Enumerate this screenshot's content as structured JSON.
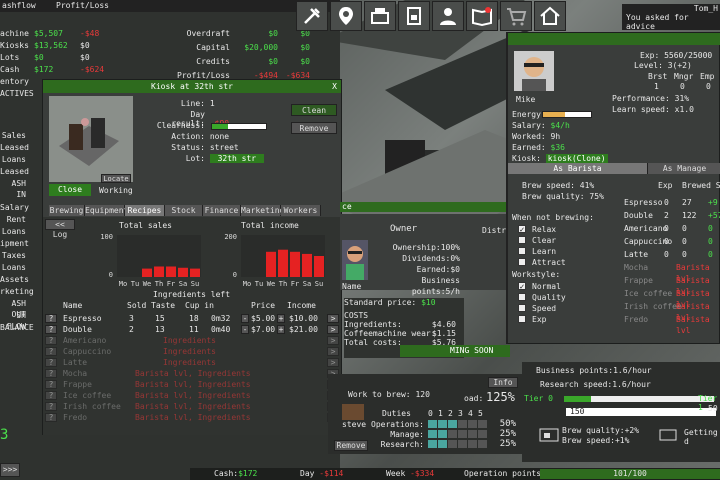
{
  "top_bar": {
    "cashflow": "ashflow",
    "profit_loss": "Profit/Loss",
    "user": "Tom_H"
  },
  "left_list": [
    {
      "label": "achine",
      "a": "$5,507",
      "b": "-$48"
    },
    {
      "label": "Kiosks",
      "a": "$13,562",
      "b": "$0"
    },
    {
      "label": "Lots",
      "a": "$0",
      "b": "$0"
    },
    {
      "label": "Cash",
      "a": "$172",
      "b": "-$624"
    },
    {
      "label": "entory",
      "a": "",
      "b": ""
    },
    {
      "label": "ACTIVES",
      "a": "",
      "b": "1"
    }
  ],
  "left_labels": [
    "Sales",
    "Leased",
    "Loans",
    "Leased",
    "ASH IN",
    "Salary",
    "Rent",
    "Loans",
    "ipment",
    "Taxes",
    "Loans",
    "Assets",
    "rketing",
    "ASH OUT",
    "SH FLOW",
    "BALANCE"
  ],
  "left_big": "3",
  "chat_btn": ">>>",
  "right_ledger": [
    {
      "label": "Overdraft",
      "a": "$0",
      "b": "$0"
    },
    {
      "label": "Capital",
      "a": "$20,000",
      "b": "$0"
    },
    {
      "label": "Credits",
      "a": "$0",
      "b": "$0"
    },
    {
      "label": "Profit/Loss",
      "a": "-$494",
      "b": "-$634"
    }
  ],
  "icons": [
    "tools-icon",
    "map-pin-icon",
    "register-icon",
    "coffee-machine-icon",
    "person-icon",
    "book-icon",
    "cart-icon",
    "home-icon"
  ],
  "notice": {
    "title": "Tom_H",
    "text": "You asked for advice"
  },
  "kiosk": {
    "title": "Kiosk at 32th str",
    "close_x": "X",
    "line_label": "Line:",
    "line": "1",
    "day_result_label": "Day result:",
    "day_result": "-$90",
    "clearness_label": "Clearness:",
    "clearness": 0.3,
    "action_label": "Action:",
    "action": "none",
    "status_label": "Status:",
    "status": "street",
    "lot_label": "Lot:",
    "lot": "32th str",
    "clean_btn": "Clean",
    "remove_btn": "Remove",
    "locate_btn": "Locate",
    "close_btn": "Close",
    "working": "Working",
    "tabs": [
      "Brewing",
      "Equipment",
      "Recipes",
      "Stock",
      "Finance",
      "Marketing",
      "Workers"
    ],
    "log_btn": "<< Log",
    "sales_title": "Total sales",
    "sales_max": "100",
    "sales_min": "0",
    "income_title": "Total income",
    "income_max": "200",
    "income_min": "0",
    "days": [
      "Mo",
      "Tu",
      "We",
      "Th",
      "Fr",
      "Sa",
      "Su"
    ],
    "sales_vals": [
      0,
      0,
      20,
      25,
      25,
      22,
      20
    ],
    "income_vals": [
      0,
      0,
      120,
      130,
      120,
      110,
      100
    ],
    "ingredients_left": "Ingredients left",
    "headers": [
      "Name",
      "Sold",
      "Taste",
      "Cup in",
      "Price",
      "Income"
    ],
    "recipes": [
      {
        "name": "Espresso",
        "sold": "3",
        "taste": "15",
        "qty": "18",
        "cup": "0m32",
        "price": "$5.00",
        "income": "$10.00",
        "active": true
      },
      {
        "name": "Double",
        "sold": "2",
        "taste": "13",
        "qty": "11",
        "cup": "0m40",
        "price": "$7.00",
        "income": "$21.00",
        "active": true
      },
      {
        "name": "Americano",
        "sold": "",
        "taste": "",
        "qty": "",
        "cup": "Ingredients",
        "price": "",
        "income": "",
        "active": false
      },
      {
        "name": "Cappuccino",
        "sold": "",
        "taste": "",
        "qty": "",
        "cup": "Ingredients",
        "price": "",
        "income": "",
        "active": false
      },
      {
        "name": "Latte",
        "sold": "",
        "taste": "",
        "qty": "",
        "cup": "Ingredients",
        "price": "",
        "income": "",
        "active": false
      },
      {
        "name": "Mocha",
        "sold": "",
        "taste": "",
        "qty": "",
        "cup": "Barista lvl, Ingredients",
        "price": "",
        "income": "",
        "active": false
      },
      {
        "name": "Frappe",
        "sold": "",
        "taste": "",
        "qty": "",
        "cup": "Barista lvl, Ingredients",
        "price": "",
        "income": "",
        "active": false
      },
      {
        "name": "Ice coffee",
        "sold": "",
        "taste": "",
        "qty": "",
        "cup": "Barista lvl, Ingredients",
        "price": "",
        "income": "",
        "active": false
      },
      {
        "name": "Irish coffee",
        "sold": "",
        "taste": "",
        "qty": "",
        "cup": "Barista lvl, Ingredients",
        "price": "",
        "income": "",
        "active": false
      },
      {
        "name": "Fredo",
        "sold": "",
        "taste": "",
        "qty": "",
        "cup": "Barista lvl, Ingredients",
        "price": "",
        "income": "",
        "active": false
      }
    ]
  },
  "owner": {
    "title": "Owner",
    "name": "Name",
    "ownership_label": "Ownership:",
    "ownership": "100%",
    "dividends_label": "Dividends:",
    "dividends": "0%",
    "earned_label": "Earned:",
    "earned": "$0",
    "bp_label": "Business points:",
    "bp": "5/h",
    "distr": "Distri",
    "standard_price_label": "Standard price:",
    "standard_price": "$10",
    "costs": "COSTS",
    "ingredients_label": "Ingredients:",
    "ingredients": "$4.60",
    "wear_label": "Coffeemachine wear:",
    "wear": "$1.15",
    "total_label": "Total costs:",
    "total": "$5.76",
    "ce": "ce"
  },
  "work": {
    "label": "Work to brew:",
    "value": "120",
    "load": "oad:",
    "load_pct": "125%",
    "worker": "steve",
    "remove": "Remove",
    "info": "Info",
    "duties_label": "Duties",
    "duty_cols": [
      "0",
      "1",
      "2",
      "3",
      "4",
      "5"
    ],
    "duties": [
      {
        "name": "Operations:",
        "pct": "50%",
        "level": 2
      },
      {
        "name": "Manage:",
        "pct": "25%",
        "level": 1
      },
      {
        "name": "Research:",
        "pct": "25%",
        "level": 1
      }
    ]
  },
  "coming_soon": "MING SOON",
  "bottom": {
    "bp_label": "Business points:",
    "bp": "1.6/hour",
    "rs_label": "Research speed:",
    "rs": "1.6/hour",
    "tier0": "Tier 0",
    "tier1": "Tier 1",
    "tier_val": "150",
    "tier_max": "50",
    "brew_quality": "Brew quality:+2%",
    "brew_speed": "Brew speed:+1%",
    "getting": "Getting d",
    "status_cash_label": "Cash:",
    "status_cash": "$172",
    "status_day_label": "Day",
    "status_day": "-$114",
    "status_week_label": "Week",
    "status_week": "-$334",
    "op_points": "Operation points",
    "op_value": "101/100"
  },
  "worker_panel": {
    "name": "Mike",
    "exp": "Exp: 5560/25000",
    "level": "Level: 3(+2)",
    "stats_headers": [
      "Brst",
      "Mngr",
      "Emp"
    ],
    "stats": [
      "1",
      "0",
      "0"
    ],
    "energy_label": "Energy:",
    "energy": 0.45,
    "salary_label": "Salary:",
    "salary": "$4/h",
    "worked_label": "Worked:",
    "worked": "9h",
    "earned_label": "Earned:",
    "earned": "$36",
    "kiosk_label": "Kiosk:",
    "kiosk": "kiosk(Clone)",
    "performance_label": "Performance:",
    "performance": "31%",
    "learn_label": "Learn speed:",
    "learn": "x1.0",
    "tab_barista": "As Barista",
    "tab_manager": "As Manage",
    "brew_speed": "Brew speed: 41%",
    "brew_quality": "Brew quality: 75%",
    "not_brewing": "When not brewing:",
    "nb_opts": [
      {
        "label": "Relax",
        "on": true
      },
      {
        "label": "Clear",
        "on": false
      },
      {
        "label": "Learn",
        "on": false
      },
      {
        "label": "Attract",
        "on": false
      }
    ],
    "workstyle": "Workstyle:",
    "ws_opts": [
      {
        "label": "Normal",
        "on": true
      },
      {
        "label": "Quality",
        "on": false
      },
      {
        "label": "Speed",
        "on": false
      },
      {
        "label": "Exp",
        "on": false
      }
    ],
    "exp_col": "Exp",
    "brewed_col": "Brewed Speed",
    "drinks": [
      {
        "name": "Espresso",
        "exp": "0",
        "brewed": "27",
        "speed": "+9",
        "active": true
      },
      {
        "name": "Double",
        "exp": "2",
        "brewed": "122",
        "speed": "+57",
        "active": true
      },
      {
        "name": "Americano",
        "exp": "0",
        "brewed": "0",
        "speed": "0",
        "active": true
      },
      {
        "name": "Cappuccino",
        "exp": "0",
        "brewed": "0",
        "speed": "0",
        "active": true
      },
      {
        "name": "Latte",
        "exp": "0",
        "brewed": "0",
        "speed": "0",
        "active": true
      },
      {
        "name": "Mocha",
        "exp": "",
        "brewed": "Barista lvl",
        "speed": "",
        "active": false
      },
      {
        "name": "Frappe",
        "exp": "",
        "brewed": "Barista lvl",
        "speed": "",
        "active": false
      },
      {
        "name": "Ice coffee",
        "exp": "",
        "brewed": "Barista lvl",
        "speed": "",
        "active": false
      },
      {
        "name": "Irish coffee",
        "exp": "",
        "brewed": "Barista lvl",
        "speed": "",
        "active": false
      },
      {
        "name": "Fredo",
        "exp": "",
        "brewed": "Barista lvl",
        "speed": "",
        "active": false
      }
    ]
  }
}
